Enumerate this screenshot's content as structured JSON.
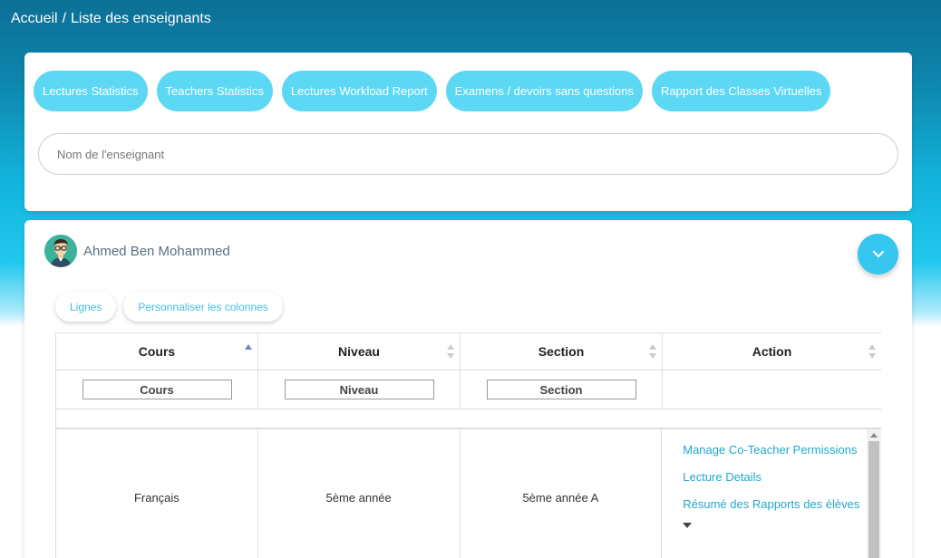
{
  "breadcrumb": {
    "home": "Accueil",
    "separator": "/",
    "current": "Liste des enseignants"
  },
  "actions_bar": {
    "buttons": [
      {
        "label": "Lectures Statistics"
      },
      {
        "label": "Teachers Statistics"
      },
      {
        "label": "Lectures Workload Report"
      },
      {
        "label": "Examens / devoirs sans questions"
      },
      {
        "label": "Rapport des Classes Virtuelles"
      }
    ]
  },
  "search": {
    "placeholder": "Nom de l'enseignant",
    "value": ""
  },
  "teacher": {
    "name": "Ahmed Ben Mohammed",
    "avatar_icon": "avatar-man-icon"
  },
  "table_controls": {
    "rows_label": "Lignes",
    "columns_label": "Personnaliser les colonnes"
  },
  "table": {
    "columns": [
      {
        "label": "Cours",
        "sort": "ascending",
        "filter_placeholder": "Cours"
      },
      {
        "label": "Niveau",
        "sort": "none",
        "filter_placeholder": "Niveau"
      },
      {
        "label": "Section",
        "sort": "none",
        "filter_placeholder": "Section"
      },
      {
        "label": "Action",
        "sort": "none"
      }
    ],
    "rows": [
      {
        "cours": "Français",
        "niveau": "5ème année",
        "section": "5ème année A",
        "actions": [
          "Manage Co-Teacher Permissions",
          "Lecture Details",
          "Résumé des Rapports des élèves"
        ]
      }
    ]
  },
  "colors": {
    "pill": "#5dd8f4",
    "link": "#21a7cc",
    "accent": "#36c6ef"
  }
}
